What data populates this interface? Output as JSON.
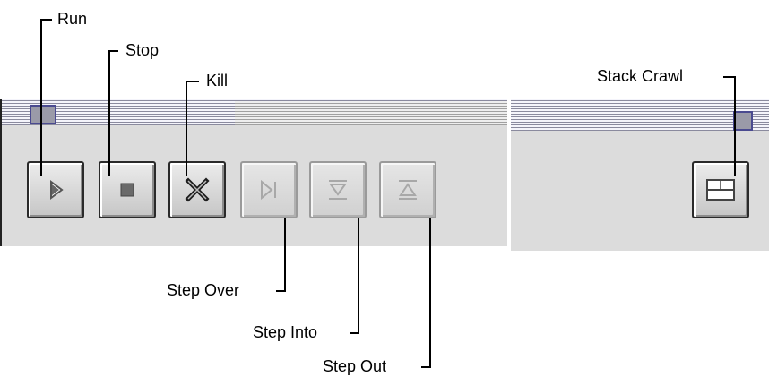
{
  "callouts": {
    "run": "Run",
    "stop": "Stop",
    "kill": "Kill",
    "step_over": "Step Over",
    "step_into": "Step Into",
    "step_out": "Step Out",
    "stack_crawl": "Stack Crawl"
  },
  "toolbar": {
    "buttons": [
      {
        "icon": "play-icon",
        "enabled": true
      },
      {
        "icon": "stop-icon",
        "enabled": true
      },
      {
        "icon": "kill-x-icon",
        "enabled": true
      },
      {
        "icon": "step-over-icon",
        "enabled": false
      },
      {
        "icon": "step-into-icon",
        "enabled": false
      },
      {
        "icon": "step-out-icon",
        "enabled": false
      }
    ]
  },
  "stack_panel": {
    "buttons": [
      {
        "icon": "stack-crawl-icon",
        "enabled": true
      }
    ]
  },
  "colors": {
    "panel": "#dcdcdc",
    "disabled_glyph": "#a8a8a8",
    "titlebar_stripe": "#8a8a9e",
    "zoom_border": "#4a4a90"
  }
}
